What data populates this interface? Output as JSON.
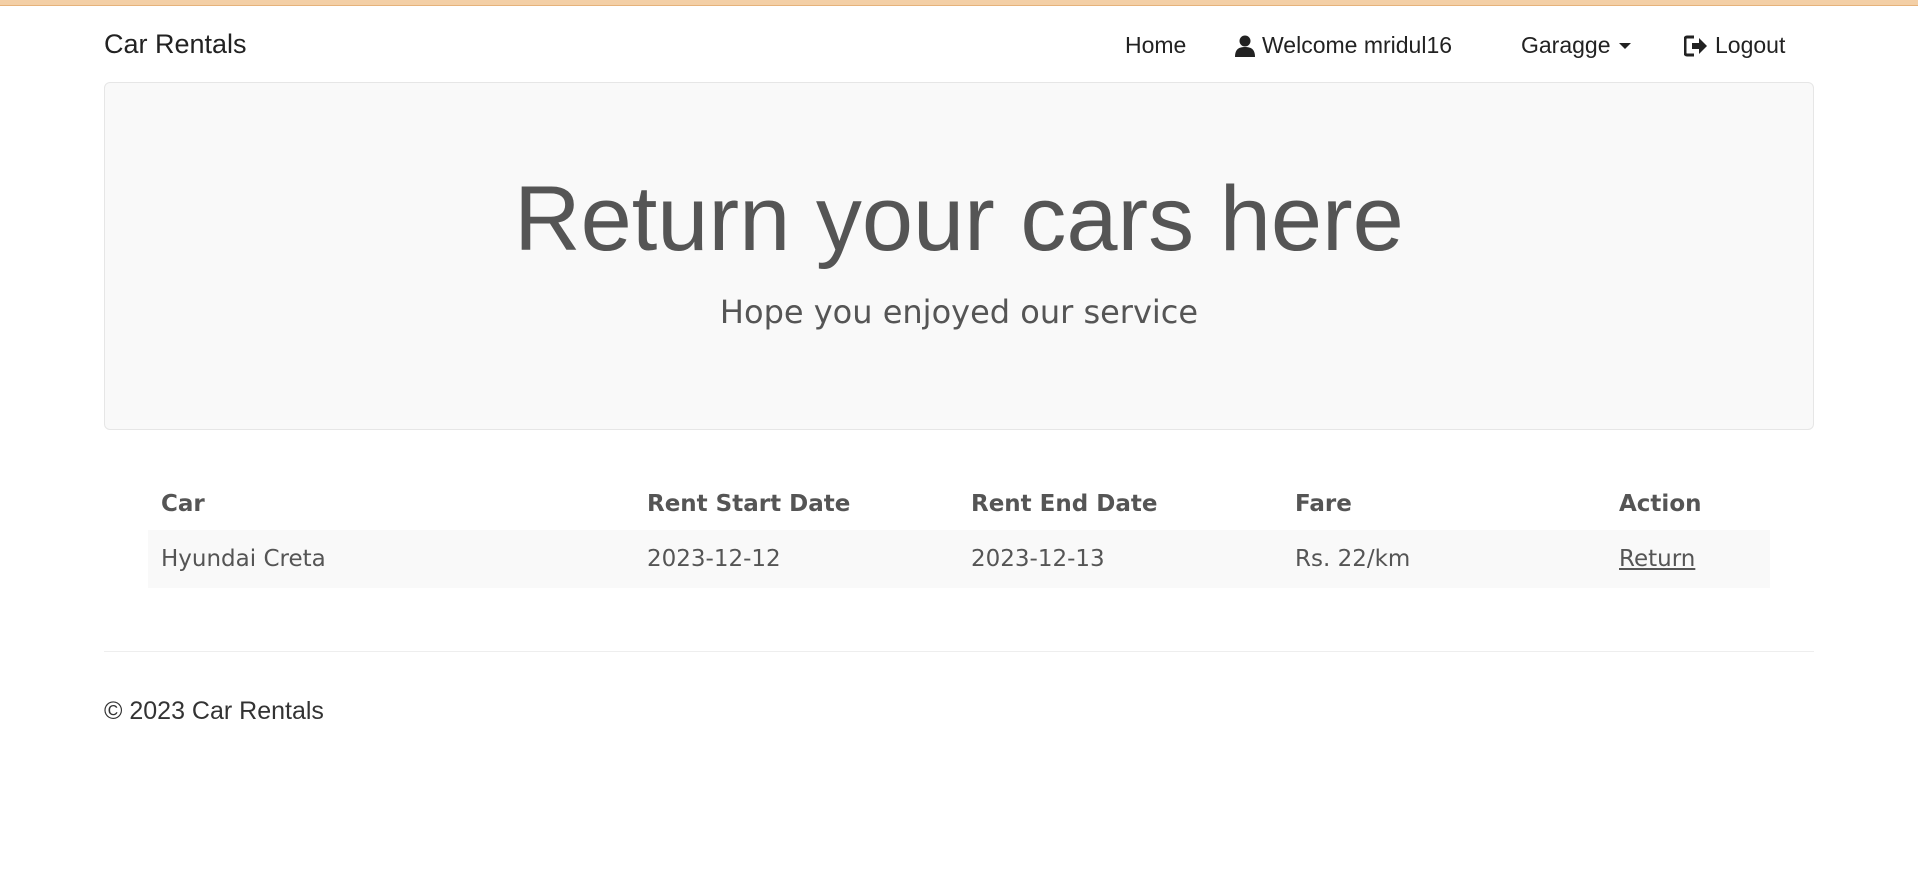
{
  "navbar": {
    "brand": "Car Rentals",
    "home": "Home",
    "welcome": "Welcome mridul16",
    "garage": "Garagge",
    "logout": "Logout",
    "icons": [
      "user-icon",
      "caret-down-icon",
      "logout-icon"
    ]
  },
  "jumbotron": {
    "title": "Return your cars here",
    "subtitle": "Hope you enjoyed our service"
  },
  "table": {
    "headers": [
      "Car",
      "Rent Start Date",
      "Rent End Date",
      "Fare",
      "Action"
    ],
    "rows": [
      {
        "car": "Hyundai Creta",
        "start": "2023-12-12",
        "end": "2023-12-13",
        "fare": "Rs. 22/km",
        "action": "Return"
      }
    ]
  },
  "footer": {
    "text": "© 2023 Car Rentals"
  },
  "colors": {
    "jumbotron_bg": "#f9f9f9",
    "text_muted": "#555555",
    "top_accent": "#f3cfa6"
  }
}
